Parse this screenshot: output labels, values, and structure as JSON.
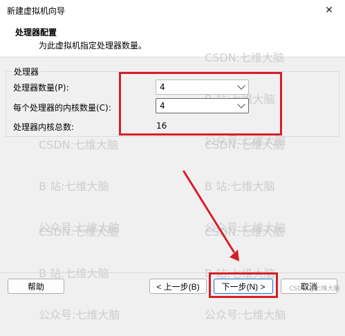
{
  "window": {
    "title": "新建虚拟机向导",
    "close_glyph": "✕"
  },
  "header": {
    "title": "处理器配置",
    "subtitle": "为此虚拟机指定处理器数量。"
  },
  "group": {
    "label": "处理器",
    "processor_count": {
      "label": "处理器数量(P):",
      "value": "4"
    },
    "cores_per_processor": {
      "label": "每个处理器的内核数量(C):",
      "value": "4"
    },
    "total_cores": {
      "label": "处理器内核总数:",
      "value": "16"
    }
  },
  "buttons": {
    "help": "帮助",
    "back": "< 上一步(B)",
    "next": "下一步(N) >",
    "cancel": "取消"
  },
  "watermark": {
    "line1": "CSDN:七维大脑",
    "line2": "B 站:七维大脑",
    "line3": "公众号:七维大脑",
    "corner": "CSDN @七维大脑"
  },
  "colors": {
    "annotation_red": "#d71e28",
    "default_button_border": "#1a6fd6"
  }
}
